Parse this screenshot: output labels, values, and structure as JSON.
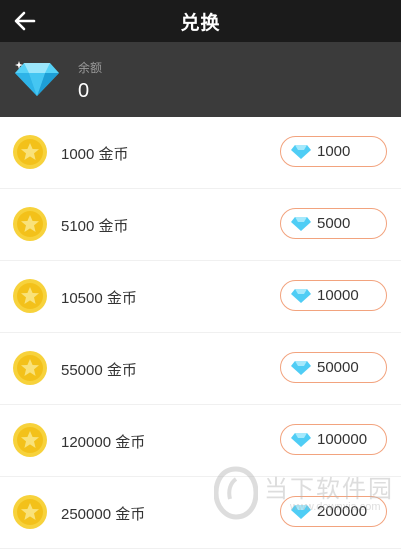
{
  "header": {
    "title": "兑换",
    "back_icon": "arrow-left-icon"
  },
  "balance": {
    "label": "余额",
    "value": "0",
    "icon": "diamond-icon"
  },
  "items": [
    {
      "gold": "1000 金币",
      "cost": "1000"
    },
    {
      "gold": "5100 金币",
      "cost": "5000"
    },
    {
      "gold": "10500 金币",
      "cost": "10000"
    },
    {
      "gold": "55000 金币",
      "cost": "50000"
    },
    {
      "gold": "120000 金币",
      "cost": "100000"
    },
    {
      "gold": "250000 金币",
      "cost": "200000"
    }
  ],
  "watermark": {
    "text": "当下软件园",
    "url": "www.downxia.com"
  },
  "colors": {
    "topbar": "#1b1b1b",
    "balance_bg": "#3b3b3b",
    "button_border": "#f2a37e",
    "coin": "#f5c518",
    "diamond": "#3fc4f3"
  }
}
